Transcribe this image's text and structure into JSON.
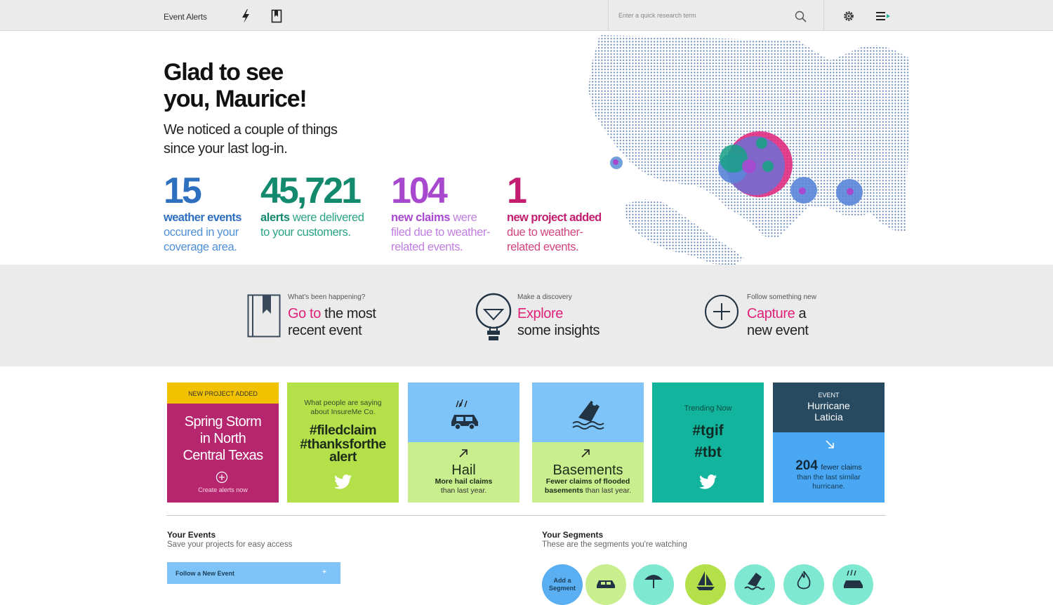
{
  "header": {
    "app_title": "Event Alerts",
    "search_placeholder": "Enter a quick research term"
  },
  "hero": {
    "title_line1": "Glad to see",
    "title_line2": "you, Maurice!",
    "sub_line1": "We noticed a couple of things",
    "sub_line2": "since your last log-in."
  },
  "stats": [
    {
      "number": "15",
      "strong": "weather events",
      "rest_line1": "occured in your",
      "rest_line2": "coverage area.",
      "color": "#2e6fc0"
    },
    {
      "number": "45,721",
      "strong": "alerts",
      "rest_line1": "were delivered",
      "rest_line2": "to your customers.",
      "color": "#13896e"
    },
    {
      "number": "104",
      "strong": "new claims",
      "rest_line1": "were",
      "rest_line2": "filed due to weather-",
      "rest_line3": "related events.",
      "color": "#a848cf"
    },
    {
      "number": "1",
      "strong": "new project added",
      "rest_line1": "due to weather-",
      "rest_line2": "related events.",
      "color": "#c21d6e"
    }
  ],
  "actions": [
    {
      "kicker": "What's been happening?",
      "highlight": "Go to",
      "rest_line1": "the most",
      "line2": "recent event"
    },
    {
      "kicker": "Make a discovery",
      "highlight": "Explore",
      "rest_line1": "",
      "line2": "some insights"
    },
    {
      "kicker": "Follow something new",
      "highlight": "Capture",
      "rest_line1": "a",
      "line2": "new event"
    }
  ],
  "cards": {
    "project": {
      "tag": "NEW PROJECT ADDED",
      "line1": "Spring Storm",
      "line2": "in North",
      "line3": "Central Texas",
      "cta": "Create alerts now"
    },
    "social": {
      "kicker1": "What people are saying",
      "kicker2": "about InsureMe Co.",
      "tag1": "#filedclaim",
      "tag2": "#thanksforthe",
      "tag3": "alert"
    },
    "hail": {
      "title": "Hail",
      "line1": "More hail claims",
      "line2": "than last year."
    },
    "basements": {
      "title": "Basements",
      "line1": "Fewer claims of flooded",
      "line2_bold": "basements",
      "line2_rest": "than last year."
    },
    "trending": {
      "kicker": "Trending Now",
      "tag1": "#tgif",
      "tag2": "#tbt"
    },
    "hurricane": {
      "tag": "EVENT",
      "name1": "Hurricane",
      "name2": "Laticia",
      "number": "204",
      "strong": "fewer claims",
      "line2": "than the last similar",
      "line3": "hurricane."
    }
  },
  "your_events": {
    "title": "Your Events",
    "subtitle": "Save your projects for easy access",
    "button": "Follow a New Event",
    "button_plus": "+"
  },
  "your_segments": {
    "title": "Your Segments",
    "subtitle": "These are the segments you're watching",
    "add_line1": "Add a",
    "add_line2": "Segment"
  },
  "colors": {
    "pink": "#e0217a",
    "yellow": "#f2c200",
    "magenta_card": "#b6266f",
    "lime": "#b4e04a",
    "sky": "#7fc4f8",
    "light_green": "#c9ee8e",
    "teal": "#12b49d",
    "navy": "#274a60",
    "blue": "#4aa7f4"
  },
  "icons": [
    "lightning-icon",
    "bookmark-icon",
    "search-icon",
    "gear-icon",
    "menu-icon",
    "twitter-icon",
    "car-icon",
    "umbrella-icon",
    "sailboat-icon",
    "flood-car-icon",
    "flame-icon",
    "hail-car-icon",
    "lightbulb-icon",
    "plus-circle-icon"
  ]
}
